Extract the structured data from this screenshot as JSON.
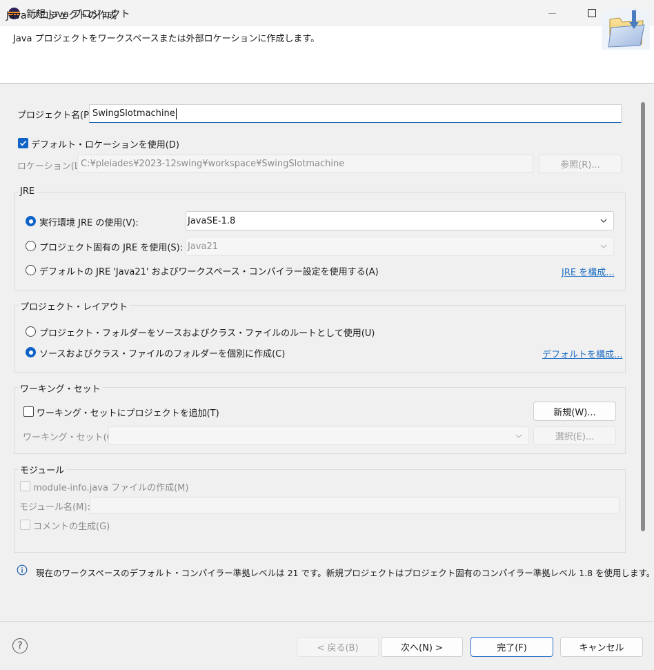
{
  "window": {
    "title": "新規 Java プロジェクト"
  },
  "header": {
    "title": "Java プロジェクトの作成",
    "description": "Java プロジェクトをワークスペースまたは外部ロケーションに作成します。"
  },
  "project_name": {
    "label": "プロジェクト名(P):",
    "value": "SwingSlotmachine"
  },
  "location": {
    "use_default_label": "デフォルト・ロケーションを使用(D)",
    "use_default_checked": true,
    "label": "ロケーション(L):",
    "value": "C:¥pleiades¥2023-12swing¥workspace¥SwingSlotmachine",
    "browse_label": "参照(R)..."
  },
  "jre": {
    "title": "JRE",
    "options": [
      {
        "label": "実行環境 JRE の使用(V):",
        "selected": true,
        "combo_value": "JavaSE-1.8"
      },
      {
        "label": "プロジェクト固有の JRE を使用(S):",
        "selected": false,
        "combo_value": "Java21"
      },
      {
        "label": "デフォルトの JRE 'Java21' およびワークスペース・コンパイラー設定を使用する(A)",
        "selected": false
      }
    ],
    "configure_link": "JRE を構成..."
  },
  "layout": {
    "title": "プロジェクト・レイアウト",
    "options": [
      {
        "label": "プロジェクト・フォルダーをソースおよびクラス・ファイルのルートとして使用(U)",
        "selected": false
      },
      {
        "label": "ソースおよびクラス・ファイルのフォルダーを個別に作成(C)",
        "selected": true
      }
    ],
    "configure_link": "デフォルトを構成..."
  },
  "working_sets": {
    "title": "ワーキング・セット",
    "add_label": "ワーキング・セットにプロジェクトを追加(T)",
    "add_checked": false,
    "new_button": "新規(W)...",
    "sets_label": "ワーキング・セット(O):",
    "select_button": "選択(E)..."
  },
  "module": {
    "title": "モジュール",
    "create_label": "module-info.java ファイルの作成(M)",
    "name_label": "モジュール名(M):",
    "comment_label": "コメントの生成(G)"
  },
  "info": {
    "icon": "info-icon",
    "message": "現在のワークスペースのデフォルト・コンパイラー準拠レベルは 21 です。新規プロジェクトはプロジェクト固有のコンパイラー準拠レベル 1.8 を使用します。"
  },
  "footer": {
    "help_icon": "help-icon",
    "back": "< 戻る(B)",
    "next": "次へ(N) >",
    "finish": "完了(F)",
    "cancel": "キャンセル"
  },
  "colors": {
    "accent": "#0f62c7",
    "link": "#1f6fc5"
  }
}
